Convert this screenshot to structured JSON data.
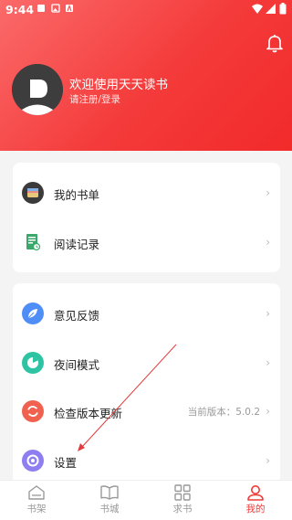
{
  "status_bar": {
    "time": "9:44"
  },
  "profile": {
    "welcome": "欢迎使用天天读书",
    "login": "请注册/登录"
  },
  "card1": {
    "items": [
      {
        "label": "我的书单",
        "icon": "booklist-icon"
      },
      {
        "label": "阅读记录",
        "icon": "reading-record-icon"
      }
    ]
  },
  "card2": {
    "items": [
      {
        "label": "意见反馈",
        "icon": "feedback-icon",
        "color": "#4f8ef7"
      },
      {
        "label": "夜间模式",
        "icon": "night-mode-icon",
        "color": "#2ec4a3"
      },
      {
        "label": "检查版本更新",
        "icon": "update-icon",
        "color": "#f0614f",
        "value": "当前版本：5.0.2"
      },
      {
        "label": "设置",
        "icon": "settings-icon",
        "color": "#8e7ef0"
      }
    ]
  },
  "tabbar": {
    "tabs": [
      {
        "label": "书架",
        "icon": "bookshelf-icon"
      },
      {
        "label": "书城",
        "icon": "bookstore-icon"
      },
      {
        "label": "求书",
        "icon": "request-book-icon"
      },
      {
        "label": "我的",
        "icon": "profile-icon",
        "active": true
      }
    ]
  },
  "colors": {
    "accent": "#f43a3a",
    "header_start": "#fb6a6a",
    "active_tab": "#f03a3a"
  }
}
